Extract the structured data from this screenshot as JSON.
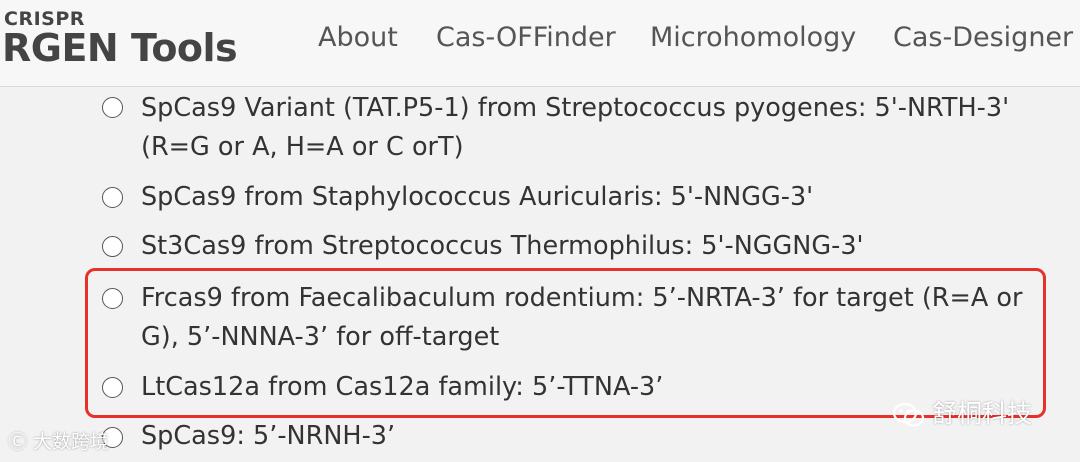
{
  "logo": {
    "small": "CRISPR",
    "big": "RGEN Tools"
  },
  "nav": [
    {
      "label": "About"
    },
    {
      "label": "Cas-OFFinder"
    },
    {
      "label": "Microhomology"
    },
    {
      "label": "Cas-Designer"
    }
  ],
  "options": [
    {
      "line1": "SpCas9 Variant (TAT.P5-1) from Streptococcus pyogenes: 5'-NRTH-3'",
      "line2": "(R=G or A, H=A or C orT)"
    },
    {
      "line1": "SpCas9 from Staphylococcus Auricularis: 5'-NNGG-3'"
    },
    {
      "line1": "St3Cas9 from Streptococcus Thermophilus: 5'-NGGNG-3'"
    },
    {
      "line1": "Frcas9 from Faecalibaculum rodentium: 5’-NRTA-3’ for target (R=A or",
      "line2": "G), 5’-NNNA-3’ for off-target"
    },
    {
      "line1": "LtCas12a from Cas12a family: 5’-TTNA-3’"
    },
    {
      "line1": "SpCas9: 5’-NRNH-3’"
    }
  ],
  "watermarks": {
    "right": "舒桐科技",
    "left": "大数跨境"
  },
  "colors": {
    "highlight": "#e8302a"
  }
}
